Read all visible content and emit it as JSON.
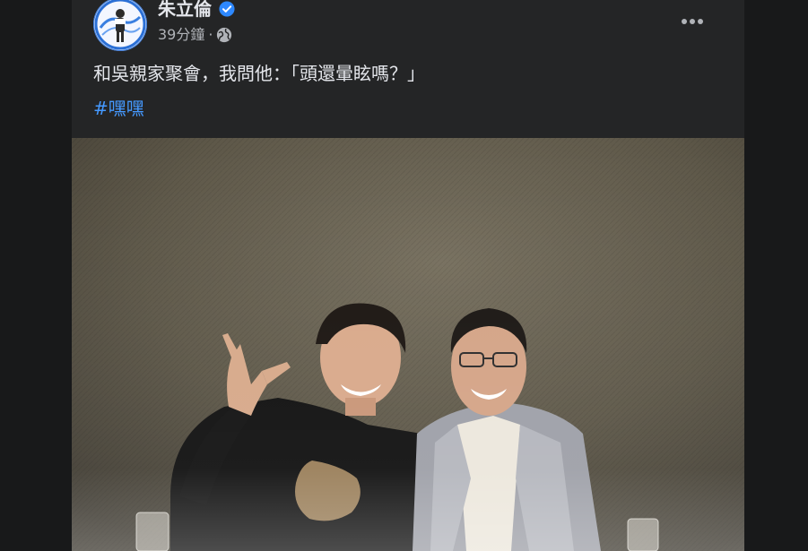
{
  "post": {
    "author": "朱立倫",
    "verified": true,
    "timestamp": "39分鐘",
    "separator": "·",
    "privacy_icon": "globe-icon",
    "more_icon": "more-options-icon",
    "text": "和吳親家聚會，我問他：「頭還暈眩嗎？」",
    "hashtag": "#嘿嘿"
  },
  "colors": {
    "background": "#18191a",
    "card": "#242526",
    "primary_text": "#e4e6eb",
    "secondary_text": "#b0b3b8",
    "link": "#4599ff",
    "verified_badge": "#2d88ff"
  }
}
